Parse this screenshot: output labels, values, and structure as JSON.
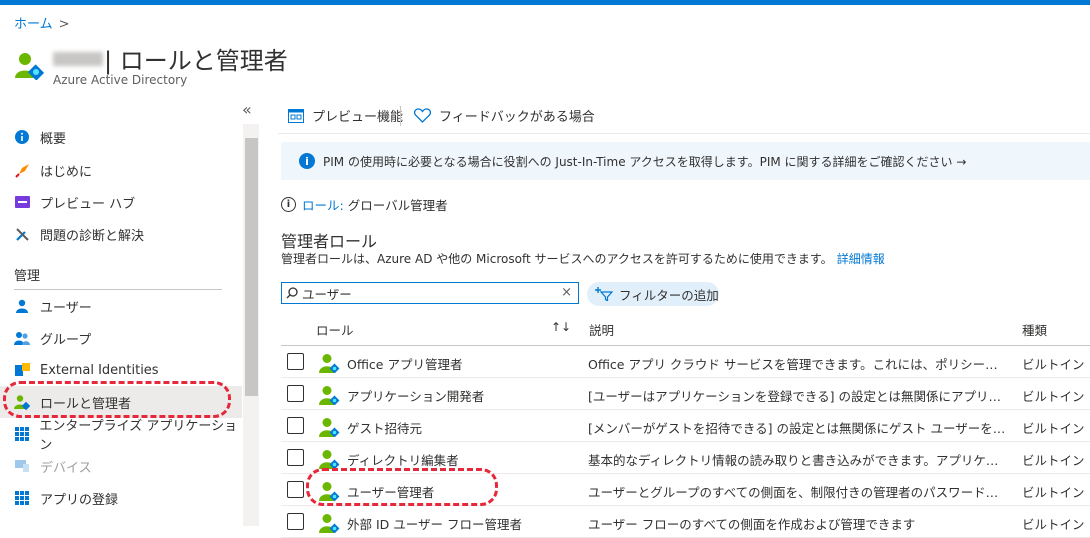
{
  "breadcrumb": {
    "home": "ホーム",
    "separator": ">"
  },
  "header": {
    "title": "| ロールと管理者",
    "subtitle": "Azure Active Directory"
  },
  "sidebar": {
    "collapse": "«",
    "items": [
      {
        "label": "概要",
        "icon": "info-icon"
      },
      {
        "label": "はじめに",
        "icon": "rocket-icon"
      },
      {
        "label": "プレビュー ハブ",
        "icon": "preview-hub-icon"
      },
      {
        "label": "問題の診断と解決",
        "icon": "wrench-icon"
      }
    ],
    "section": "管理",
    "manage_items": [
      {
        "label": "ユーザー",
        "icon": "user-icon"
      },
      {
        "label": "グループ",
        "icon": "group-icon"
      },
      {
        "label": "External Identities",
        "icon": "external-identities-icon"
      },
      {
        "label": "ロールと管理者",
        "icon": "roles-icon",
        "active": true
      },
      {
        "label": "エンタープライズ アプリケーション",
        "icon": "enterprise-apps-icon"
      },
      {
        "label": "デバイス",
        "icon": "device-icon",
        "disabled": true
      },
      {
        "label": "アプリの登録",
        "icon": "app-registration-icon"
      }
    ]
  },
  "toolbar": {
    "preview": "プレビュー機能",
    "feedback": "フィードバックがある場合"
  },
  "info_banner": "PIM の使用時に必要となる場合に役割への Just-In-Time アクセスを取得します。PIM に関する詳細をご確認ください →",
  "role_info": {
    "link": "ロール:",
    "value": "グローバル管理者"
  },
  "section": {
    "title": "管理者ロール",
    "description": "管理者ロールは、Azure AD や他の Microsoft サービスへのアクセスを許可するために使用できます。",
    "link": "詳細情報"
  },
  "search": {
    "value": "ユーザー",
    "clear": "×"
  },
  "filter_button": "フィルターの追加",
  "table": {
    "headers": {
      "role": "ロール",
      "sort": "↑↓",
      "description": "説明",
      "type": "種類"
    },
    "rows": [
      {
        "name": "Office アプリ管理者",
        "desc": "Office アプリ クラウド サービスを管理できます。これには、ポリシーと設定の管理、エ...",
        "type": "ビルトイン"
      },
      {
        "name": "アプリケーション開発者",
        "desc": "[ユーザーはアプリケーションを登録できる] の設定とは無関係にアプリケーション登録...",
        "type": "ビルトイン"
      },
      {
        "name": "ゲスト招待元",
        "desc": "[メンバーがゲストを招待できる] の設定とは無関係にゲスト ユーザーを招待できます。",
        "type": "ビルトイン"
      },
      {
        "name": "ディレクトリ編集者",
        "desc": "基本的なディレクトリ情報の読み取りと書き込みができます。アプリケーションにアク...",
        "type": "ビルトイン"
      },
      {
        "name": "ユーザー管理者",
        "desc": "ユーザーとグループのすべての側面を、制限付きの管理者のパスワードをリセットする...",
        "type": "ビルトイン"
      },
      {
        "name": "外部 ID ユーザー フロー管理者",
        "desc": "ユーザー フローのすべての側面を作成および管理できます",
        "type": "ビルトイン"
      }
    ]
  },
  "colors": {
    "accent": "#0078d4",
    "annotation": "#e5283a",
    "banner": "#eff6fc",
    "active_nav": "#edebe9"
  }
}
